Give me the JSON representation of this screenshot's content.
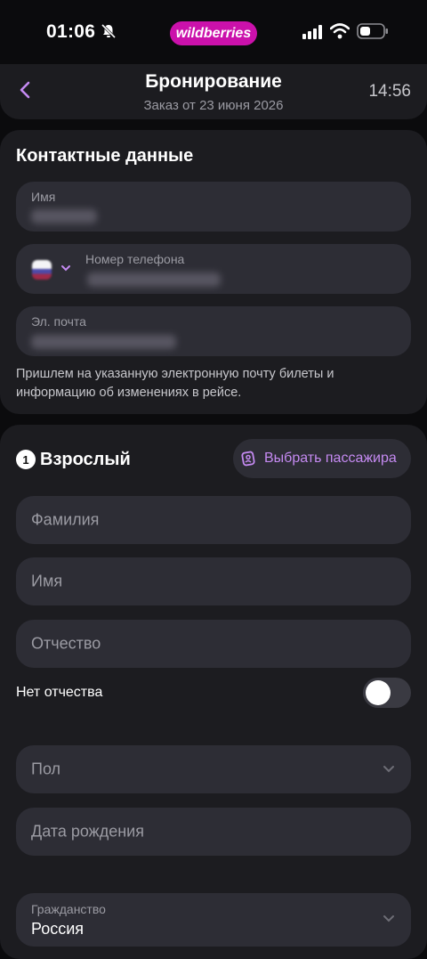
{
  "status_bar": {
    "time": "01:06",
    "brand": "wildberries",
    "icons": [
      "bell-off-icon",
      "signal-icon",
      "wifi-icon",
      "battery-icon"
    ]
  },
  "header": {
    "title": "Бронирование",
    "subtitle": "Заказ от 23 июня 2026",
    "timer": "14:56",
    "back_icon": "chevron-left-icon"
  },
  "contacts": {
    "title": "Контактные данные",
    "name_label": "Имя",
    "phone_label": "Номер телефона",
    "email_label": "Эл. почта",
    "hint": "Пришлем на указанную электронную почту билеты и информацию об изменениях в рейсе."
  },
  "passenger": {
    "number": "1",
    "title": "Взрослый",
    "choose_button": "Выбрать пассажира",
    "surname_placeholder": "Фамилия",
    "name_placeholder": "Имя",
    "patronymic_placeholder": "Отчество",
    "no_patronymic_label": "Нет отчества",
    "no_patronymic_on": false,
    "gender_placeholder": "Пол",
    "birthdate_placeholder": "Дата рождения",
    "citizenship_label": "Гражданство",
    "citizenship_value": "Россия"
  },
  "colors": {
    "accent": "#cb11ab",
    "link": "#c58af2",
    "card": "#1c1c20",
    "field": "#2d2d35"
  }
}
